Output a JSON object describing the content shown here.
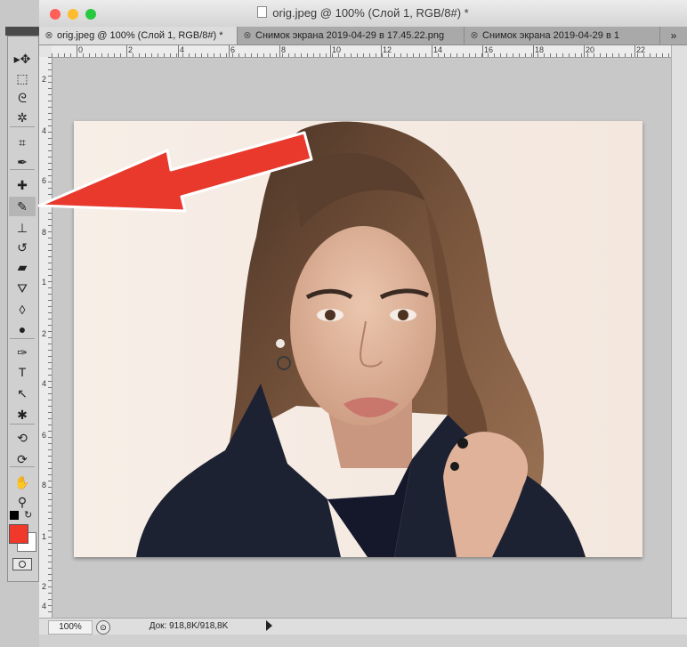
{
  "window": {
    "title": "orig.jpeg @ 100% (Слой 1, RGB/8#) *",
    "traffic_colors": [
      "#fe5f57",
      "#febc2e",
      "#28c840"
    ]
  },
  "tabs": [
    {
      "label": "orig.jpeg @ 100% (Слой 1, RGB/8#) *",
      "active": true
    },
    {
      "label": "Снимок экрана 2019-04-29 в 17.45.22.png",
      "active": false
    },
    {
      "label": "Снимок экрана 2019-04-29 в 1",
      "active": false
    }
  ],
  "tab_overflow": "»",
  "tools": [
    {
      "name": "move-tool",
      "glyph": "▸✥"
    },
    {
      "name": "marquee-tool",
      "glyph": "⬚"
    },
    {
      "name": "lasso-tool",
      "glyph": "ᘓ"
    },
    {
      "name": "magic-wand-tool",
      "glyph": "✲"
    },
    {
      "name": "crop-tool",
      "glyph": "⌗"
    },
    {
      "name": "eyedropper-tool",
      "glyph": "✒"
    },
    {
      "name": "spot-healing-tool",
      "glyph": "✚"
    },
    {
      "name": "brush-tool",
      "glyph": "✎"
    },
    {
      "name": "clone-stamp-tool",
      "glyph": "⊥"
    },
    {
      "name": "history-brush-tool",
      "glyph": "↺"
    },
    {
      "name": "eraser-tool",
      "glyph": "▰"
    },
    {
      "name": "paint-bucket-tool",
      "glyph": "⛛"
    },
    {
      "name": "blur-tool",
      "glyph": "◊"
    },
    {
      "name": "dodge-tool",
      "glyph": "●"
    },
    {
      "name": "pen-tool",
      "glyph": "✑"
    },
    {
      "name": "type-tool",
      "glyph": "T"
    },
    {
      "name": "path-selection-tool",
      "glyph": "↖"
    },
    {
      "name": "shape-tool",
      "glyph": "✱"
    },
    {
      "name": "3d-rotate-tool",
      "glyph": "⟲"
    },
    {
      "name": "3d-orbit-tool",
      "glyph": "⟳"
    },
    {
      "name": "hand-tool",
      "glyph": "✋"
    },
    {
      "name": "zoom-tool",
      "glyph": "⚲"
    }
  ],
  "colors": {
    "foreground": "#f0392b",
    "background": "#ffffff",
    "arrow": "#e8392c"
  },
  "ruler_h_labels": [
    "0",
    "2",
    "4",
    "6",
    "8",
    "10",
    "12",
    "14",
    "16",
    "18",
    "20",
    "22"
  ],
  "ruler_v_labels": [
    "2",
    "4",
    "6",
    "8",
    "1",
    "2",
    "4",
    "6",
    "8",
    "1",
    "2",
    "4",
    "6",
    "8"
  ],
  "status": {
    "zoom": "100%",
    "doc_info": "Док: 918,8K/918,8K"
  }
}
